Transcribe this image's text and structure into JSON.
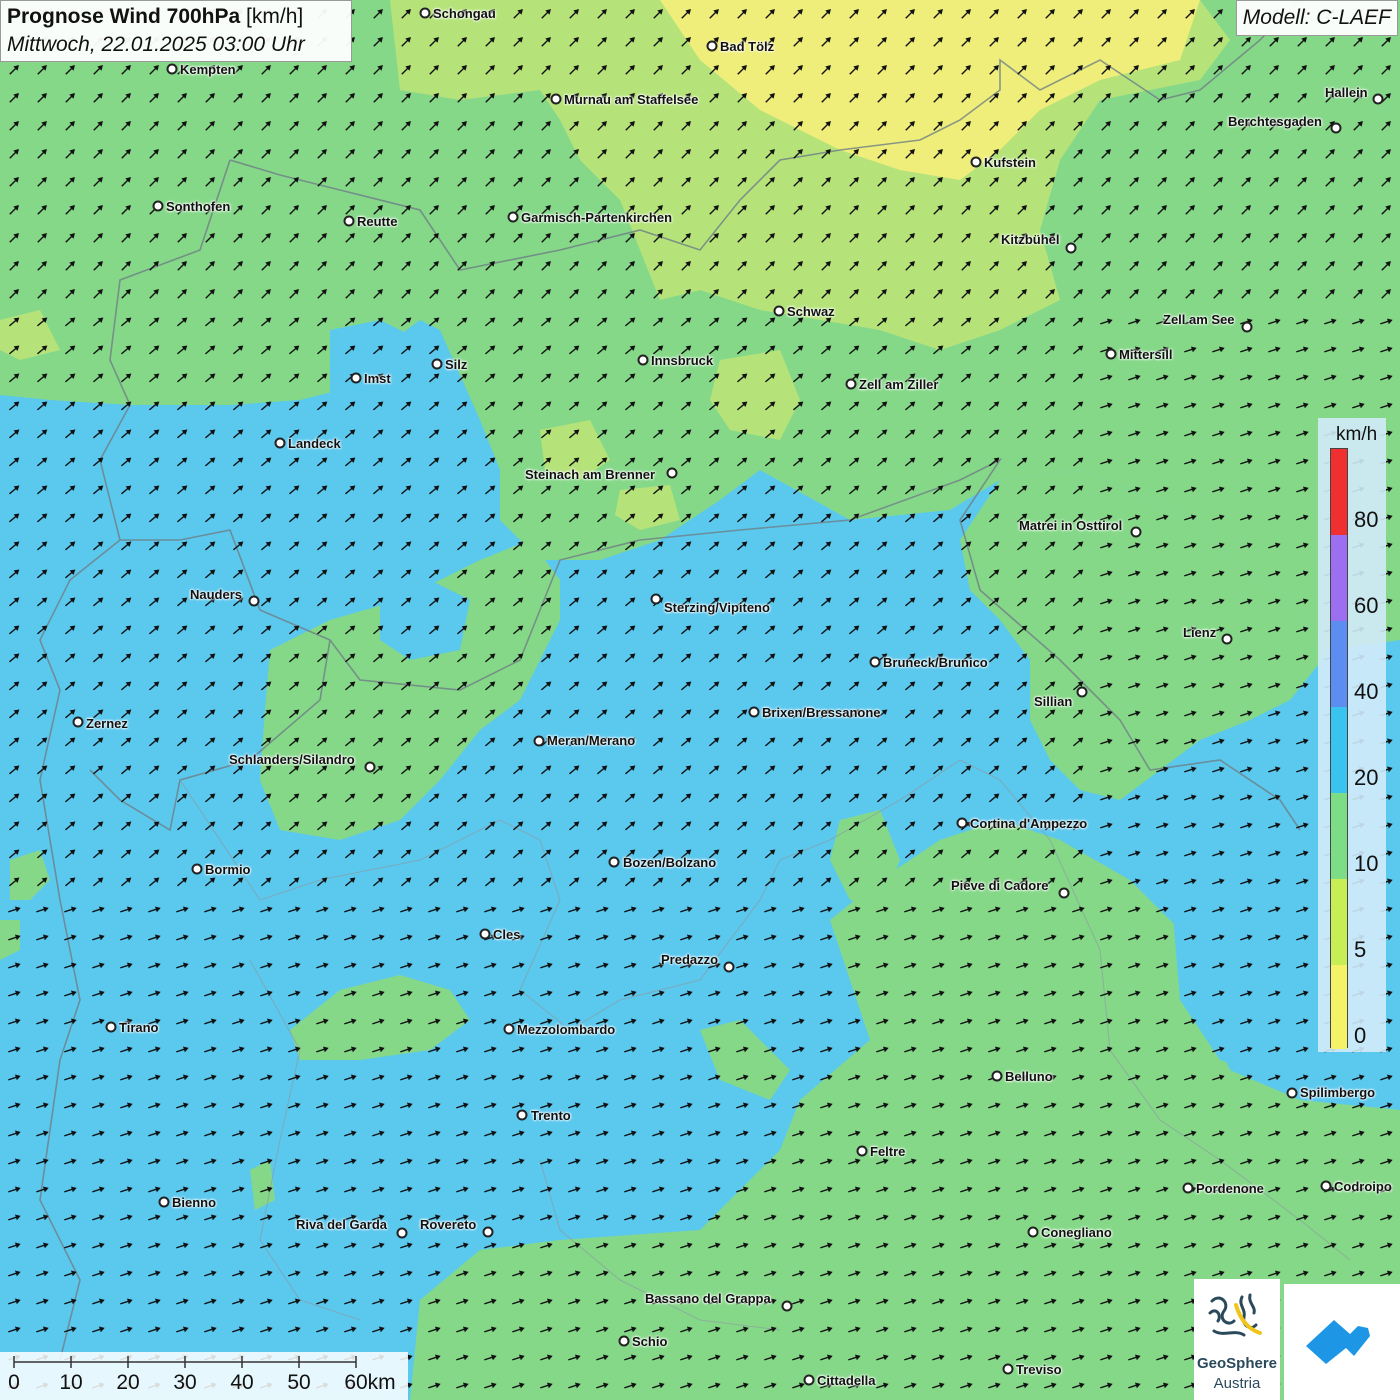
{
  "header": {
    "title_bold": "Prognose Wind 700hPa",
    "title_unit": "[km/h]",
    "datetime": "Mittwoch, 22.01.2025 03:00 Uhr",
    "model": "Modell: C-LAEF"
  },
  "legend": {
    "unit": "km/h",
    "ticks": [
      "80",
      "60",
      "40",
      "20",
      "10",
      "5",
      "0"
    ],
    "colors": [
      "#f03030",
      "#9b6ff0",
      "#5b8ef0",
      "#38c4ee",
      "#7ddc86",
      "#c7ef55",
      "#f4f266"
    ]
  },
  "scale_bar": {
    "labels": [
      "0",
      "10",
      "20",
      "30",
      "40",
      "50",
      "60km"
    ]
  },
  "logos": {
    "geosphere_line1": "GeoSphere",
    "geosphere_line2": "Austria"
  },
  "map": {
    "wind_direction": "from south-west",
    "colors": {
      "blue": "#5bc8ee",
      "green": "#86d889",
      "light_green": "#b5e37a",
      "yellow": "#efee7a"
    }
  },
  "cities": [
    "Schongau",
    "Bad Tölz",
    "Kempten",
    "Hallein",
    "Murnau am Staffelsee",
    "Berchtesgaden",
    "Kufstein",
    "Sonthofen",
    "Reutte",
    "Garmisch-Partenkirchen",
    "Kitzbühel",
    "Schwaz",
    "Zell am See",
    "Mittersill",
    "Imst",
    "Silz",
    "Innsbruck",
    "Zell am Ziller",
    "Landeck",
    "Steinach am Brenner",
    "Matrei in Osttirol",
    "Nauders",
    "Sterzing/Vipiteno",
    "Lienz",
    "Bruneck/Brunico",
    "Sillian",
    "Brixen/Bressanone",
    "Zernez",
    "Meran/Merano",
    "Schlanders/Silandro",
    "Cortina d'Ampezzo",
    "Bozen/Bolzano",
    "Bormio",
    "Pieve di Cadore",
    "Cles",
    "Predazzo",
    "Tirano",
    "Mezzolombardo",
    "Belluno",
    "Spilimbergo",
    "Trento",
    "Feltre",
    "Bienno",
    "Pordenone",
    "Codroipo",
    "Riva del Garda",
    "Rovereto",
    "Conegliano",
    "Bassano del Grappa",
    "Schio",
    "Treviso",
    "Cittadella"
  ]
}
